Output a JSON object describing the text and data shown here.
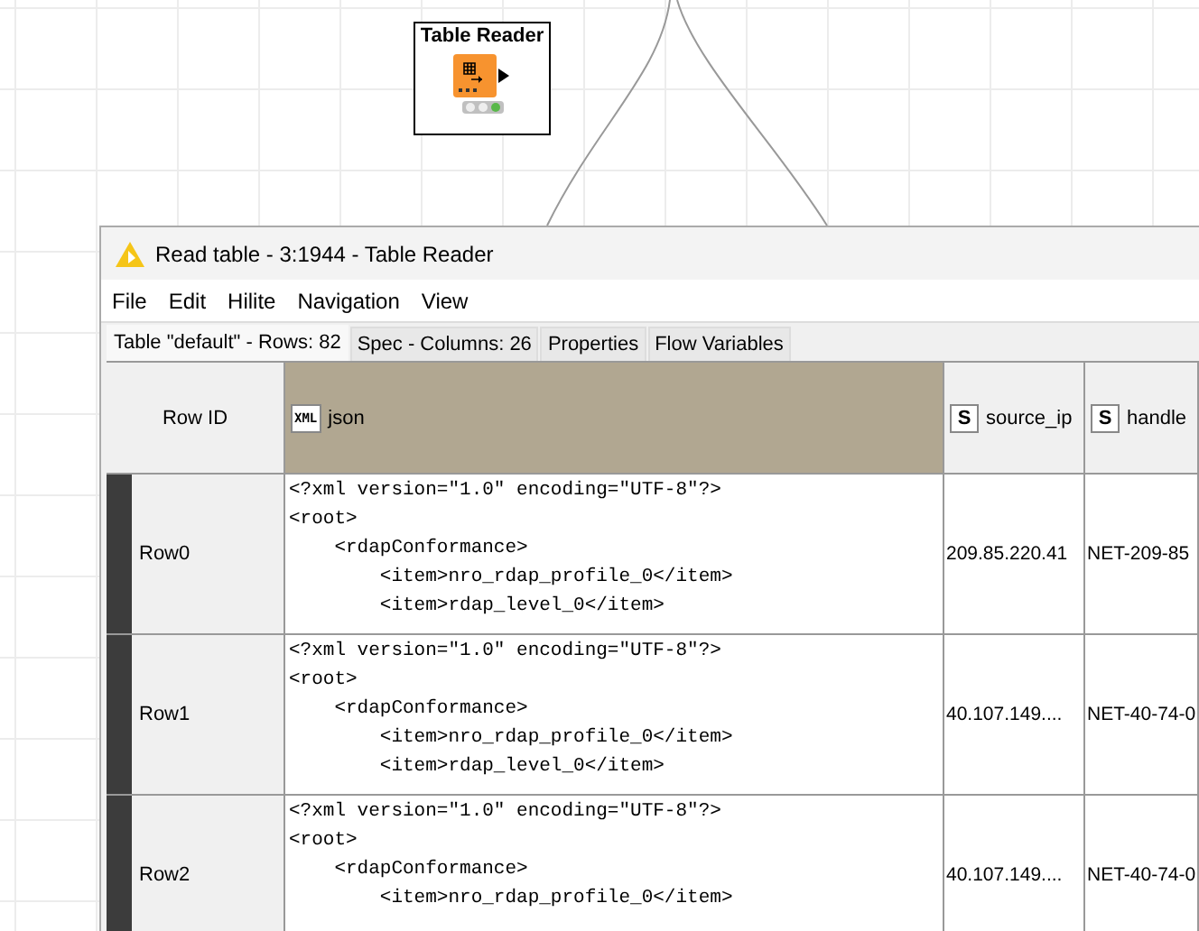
{
  "node": {
    "title": "Table Reader",
    "status_lights": [
      {
        "on": false
      },
      {
        "on": false
      },
      {
        "on": true
      }
    ]
  },
  "window": {
    "title": "Read table - 3:1944 - Table Reader"
  },
  "menu": [
    "File",
    "Edit",
    "Hilite",
    "Navigation",
    "View"
  ],
  "tabs": [
    {
      "label": "Table \"default\" - Rows: 82",
      "selected": true
    },
    {
      "label": "Spec - Columns: 26",
      "selected": false
    },
    {
      "label": "Properties",
      "selected": false
    },
    {
      "label": "Flow Variables",
      "selected": false
    }
  ],
  "table": {
    "row_id_header": "Row ID",
    "columns": [
      {
        "type_label": "XML",
        "name": "json",
        "selected": true
      },
      {
        "type_label": "S",
        "name": "source_ip",
        "selected": false
      },
      {
        "type_label": "S",
        "name": "handle",
        "selected": false
      }
    ],
    "rows": [
      {
        "id": "Row0",
        "json": [
          "<?xml version=\"1.0\" encoding=\"UTF-8\"?>",
          "<root>",
          "    <rdapConformance>",
          "        <item>nro_rdap_profile_0</item>",
          "        <item>rdap_level_0</item>"
        ],
        "source_ip": "209.85.220.41",
        "handle": "NET-209-85"
      },
      {
        "id": "Row1",
        "json": [
          "<?xml version=\"1.0\" encoding=\"UTF-8\"?>",
          "<root>",
          "    <rdapConformance>",
          "        <item>nro_rdap_profile_0</item>",
          "        <item>rdap_level_0</item>"
        ],
        "source_ip": "40.107.149....",
        "handle": "NET-40-74-0"
      },
      {
        "id": "Row2",
        "json": [
          "<?xml version=\"1.0\" encoding=\"UTF-8\"?>",
          "<root>",
          "    <rdapConformance>",
          "        <item>nro_rdap_profile_0</item>"
        ],
        "source_ip": "40.107.149....",
        "handle": "NET-40-74-0"
      }
    ]
  }
}
